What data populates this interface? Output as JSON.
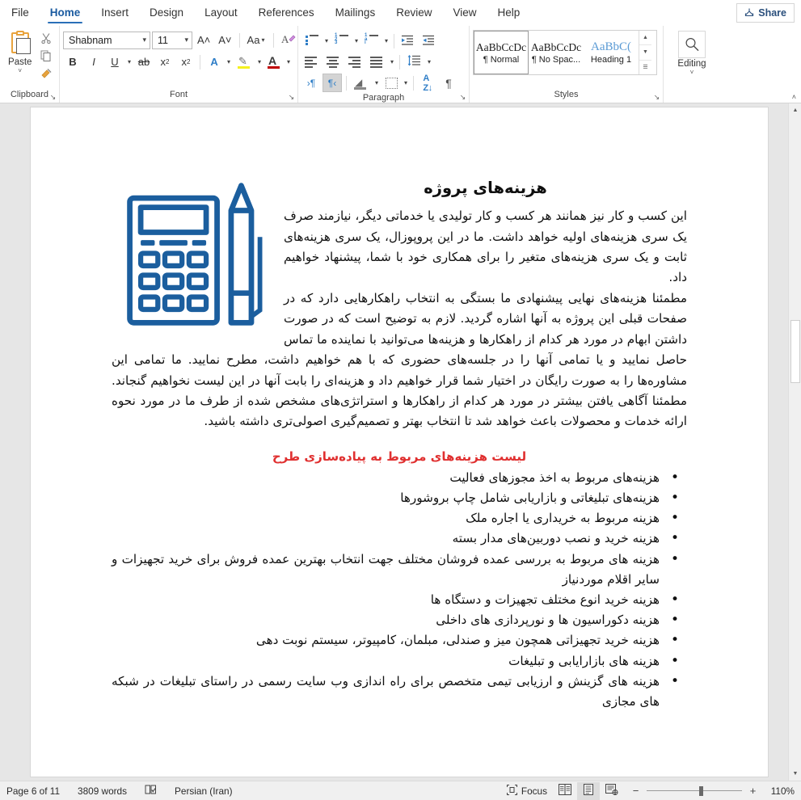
{
  "window": {
    "tabs": [
      {
        "label": "File",
        "active": false
      },
      {
        "label": "Home",
        "active": true
      },
      {
        "label": "Insert",
        "active": false
      },
      {
        "label": "Design",
        "active": false
      },
      {
        "label": "Layout",
        "active": false
      },
      {
        "label": "References",
        "active": false
      },
      {
        "label": "Mailings",
        "active": false
      },
      {
        "label": "Review",
        "active": false
      },
      {
        "label": "View",
        "active": false
      },
      {
        "label": "Help",
        "active": false
      }
    ],
    "share_label": "Share",
    "share_icon": "share-icon"
  },
  "ribbon": {
    "groups": {
      "clipboard": {
        "label": "Clipboard",
        "paste_label": "Paste",
        "paste_caret": "˅",
        "cut_icon": "scissors-icon",
        "copy_icon": "copy-icon",
        "format_painter_icon": "format-painter-icon",
        "dialog_launcher": "↘"
      },
      "font": {
        "label": "Font",
        "font_name": "Shabnam",
        "font_size": "11",
        "grow_font": "A˄",
        "shrink_font": "A˅",
        "change_case": "Aa",
        "clear_formatting": "A",
        "bold": "B",
        "italic": "I",
        "underline": "U",
        "strikethrough": "ab",
        "subscript": "x",
        "superscript": "x",
        "text_effects": "A",
        "highlight_icon": "highlight-pen-icon",
        "font_color_icon": "font-color-icon",
        "dialog_launcher": "↘"
      },
      "paragraph": {
        "label": "Paragraph",
        "bullets_icon": "bullet-list-icon",
        "numbering_icon": "numbered-list-icon",
        "multilevel_icon": "multilevel-list-icon",
        "decrease_indent_icon": "decrease-indent-icon",
        "increase_indent_icon": "increase-indent-icon",
        "align_left_icon": "align-left-icon",
        "align_center_icon": "align-center-icon",
        "align_right_icon": "align-right-icon",
        "justify_icon": "justify-icon",
        "line_spacing_icon": "line-spacing-icon",
        "ltr_icon": "left-to-right-icon",
        "rtl_icon": "right-to-left-icon",
        "shading_icon": "shading-icon",
        "borders_icon": "borders-icon",
        "sort_icon": "sort-icon",
        "show_marks_icon": "show-formatting-marks-icon",
        "dialog_launcher": "↘"
      },
      "styles": {
        "label": "Styles",
        "items": [
          {
            "preview": "AaBbCcDc",
            "name": "¶ Normal",
            "selected": true
          },
          {
            "preview": "AaBbCcDc",
            "name": "¶ No Spac...",
            "selected": false
          },
          {
            "preview": "AaBbC(",
            "name": "Heading 1",
            "selected": false
          }
        ],
        "dialog_launcher": "↘"
      },
      "editing": {
        "label": "Editing",
        "icon": "magnifier-icon",
        "caret": "˅"
      }
    },
    "collapse_icon": "˄"
  },
  "document": {
    "title": "هزینه‌های پروژه",
    "paragraphs": [
      "این کسب و کار نیز همانند هر کسب و کار تولیدی یا خدماتی دیگر، نیازمند صرف یک سری هزینه‌های اولیه خواهد داشت. ما در این پروپوزال، یک سری هزینه‌های ثابت و یک سری هزینه‌های متغیر را برای همکاری خود با شما، پیشنهاد خواهیم داد.",
      "مطمئنا هزینه‌های نهایی پیشنهادی ما بستگی به انتخاب راهکارهایی دارد که در صفحات قبلی این پروژه به آنها اشاره گردید. لازم به توضیح است که در صورت داشتن ابهام در مورد هر کدام از راهکارها و هزینه‌ها می‌توانید با نماینده ما تماس حاصل نمایید و یا تمامی آنها را در جلسه‌های حضوری که با هم خواهیم داشت، مطرح نمایید. ما تمامی این مشاوره‌ها را به صورت رایگان در اختیار شما قرار خواهیم داد و هزینه‌ای را بابت آنها در این لیست نخواهیم گنجاند. مطمئنا آگاهی یافتن بیشتر در مورد هر کدام از راهکارها و استراتژی‌های مشخص شده از طرف ما در مورد نحوه ارائه خدمات و محصولات باعث خواهد شد تا انتخاب بهتر و تصمیم‌گیری اصولی‌تری داشته باشید."
    ],
    "section_heading": "لیست هزینه‌های مربوط به پیاده‌سازی طرح",
    "section_heading_color": "#e03030",
    "bullets": [
      "هزینه‌های مربوط به اخذ مجوزهای فعالیت",
      "هزینه‌های تبلیغاتی و بازاریابی شامل چاپ بروشورها",
      "هزینه مربوط به خریداری یا اجاره ملک",
      "هزینه خرید و نصب دوربین‌های مدار بسته",
      "هزینه های مربوط به بررسی عمده فروشان مختلف جهت انتخاب بهترین عمده فروش برای خرید تجهیزات و سایر اقلام موردنیاز",
      "هزینه خرید انوع مختلف تجهیزات و دستگاه ها",
      "هزینه دکوراسیون ها و نورپردازی های داخلی",
      "هزینه خرید تجهیزاتی همچون میز و صندلی، مبلمان، کامپیوتر، سیستم نوبت دهی",
      "هزینه های بازارایابی و تبلیغات",
      "هزینه های گزینش و ارزیابی تیمی متخصص برای راه اندازی وب سایت رسمی در راستای تبلیغات در شبکه های مجازی"
    ],
    "illustration": {
      "name": "calculator-and-pencil-illustration",
      "color": "#1b5e9e"
    }
  },
  "status_bar": {
    "page": "Page 6 of 11",
    "words": "3809 words",
    "proofing_icon": "proofing-errors-icon",
    "language": "Persian (Iran)",
    "focus_label": "Focus",
    "focus_icon": "focus-mode-icon",
    "read_mode_icon": "read-mode-icon",
    "print_layout_icon": "print-layout-icon",
    "web_layout_icon": "web-layout-icon",
    "zoom_out": "−",
    "zoom_in": "+",
    "zoom_level": "110%"
  },
  "scrollbar": {
    "up_arrow": "▲",
    "down_arrow": "▼"
  }
}
